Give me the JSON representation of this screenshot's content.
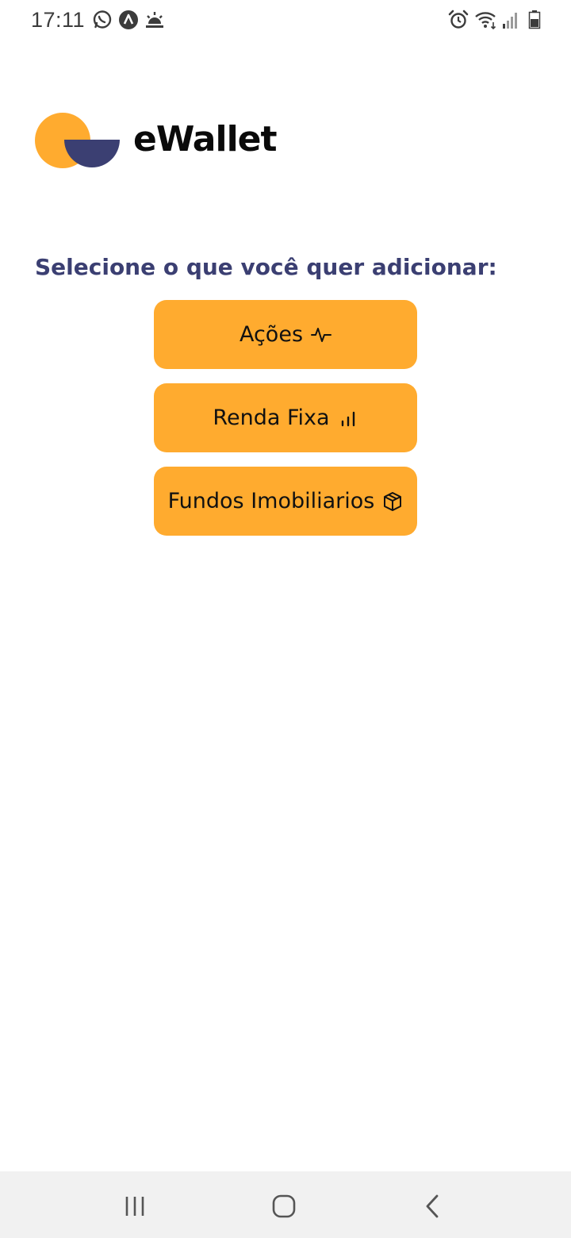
{
  "status_bar": {
    "time": "17:11",
    "left_icons": [
      "whatsapp-icon",
      "navigation-icon",
      "weather-sunrise-icon"
    ],
    "right_icons": [
      "alarm-icon",
      "wifi-icon",
      "signal-icon",
      "battery-icon"
    ]
  },
  "app": {
    "brand": "eWallet",
    "colors": {
      "accent": "#ffab2f",
      "primary": "#3b3f72",
      "text": "#111111"
    }
  },
  "main": {
    "prompt": "Selecione o que você quer adicionar:",
    "options": [
      {
        "label": "Ações",
        "icon": "activity-icon"
      },
      {
        "label": "Renda Fixa",
        "icon": "bar-chart-icon"
      },
      {
        "label": "Fundos Imobiliarios",
        "icon": "box-icon"
      }
    ]
  },
  "nav_bar": {
    "buttons": [
      "recent-apps-icon",
      "home-icon",
      "back-icon"
    ]
  }
}
